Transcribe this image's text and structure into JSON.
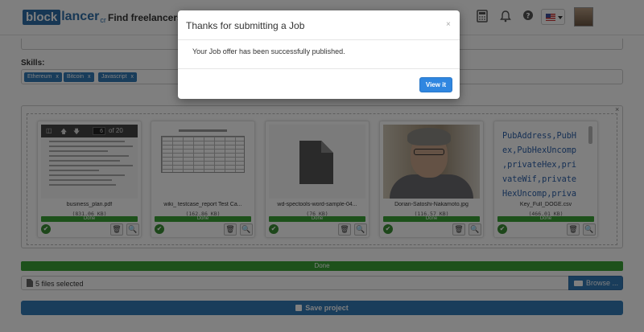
{
  "header": {
    "logo_block": "block",
    "logo_rest": "lancer",
    "logo_tail": "cr",
    "nav_link": "Find freelancers"
  },
  "form": {
    "skills_label": "Skills:",
    "skills": [
      {
        "label": "Ethereum"
      },
      {
        "label": "Bitcoin"
      },
      {
        "label": "Javascript"
      }
    ],
    "tag_remove": "x",
    "upload_close": "×"
  },
  "files": [
    {
      "name": "business_plan.pdf",
      "size": "(831.06 KB)",
      "status": "Done",
      "kind": "pdf",
      "pdf_current_page": "6",
      "pdf_total_pages": "of 20"
    },
    {
      "name": "wiki_ testcase_report Test Ca...",
      "size": "(162.86 KB)",
      "status": "Done",
      "kind": "spreadsheet"
    },
    {
      "name": "wd-spectools-word-sample-04...",
      "size": "(76 KB)",
      "status": "Done",
      "kind": "document"
    },
    {
      "name": "Dorian-Satoshi-Nakamoto.jpg",
      "size": "(116.57 KB)",
      "status": "Done",
      "kind": "image"
    },
    {
      "name": "Key_Full_DOGE.csv",
      "size": "(466.01 KB)",
      "status": "Done",
      "kind": "csv",
      "preview_text": "PubAddress,PubH\nex,PubHexUncomp\n,privateHex,pri\nvateWif,private\nHexUncomp,priva"
    }
  ],
  "progress": {
    "label": "Done",
    "percent": 100
  },
  "file_count_text": "5 files selected",
  "browse_label": "Browse ...",
  "save_label": "Save project",
  "modal": {
    "title": "Thanks for submitting a Job",
    "close": "×",
    "message": "Your Job offer has been successfully published.",
    "view_label": "View it"
  },
  "colors": {
    "primary": "#337ab7",
    "success": "#3aa336",
    "modal_button": "#2f86e0"
  }
}
